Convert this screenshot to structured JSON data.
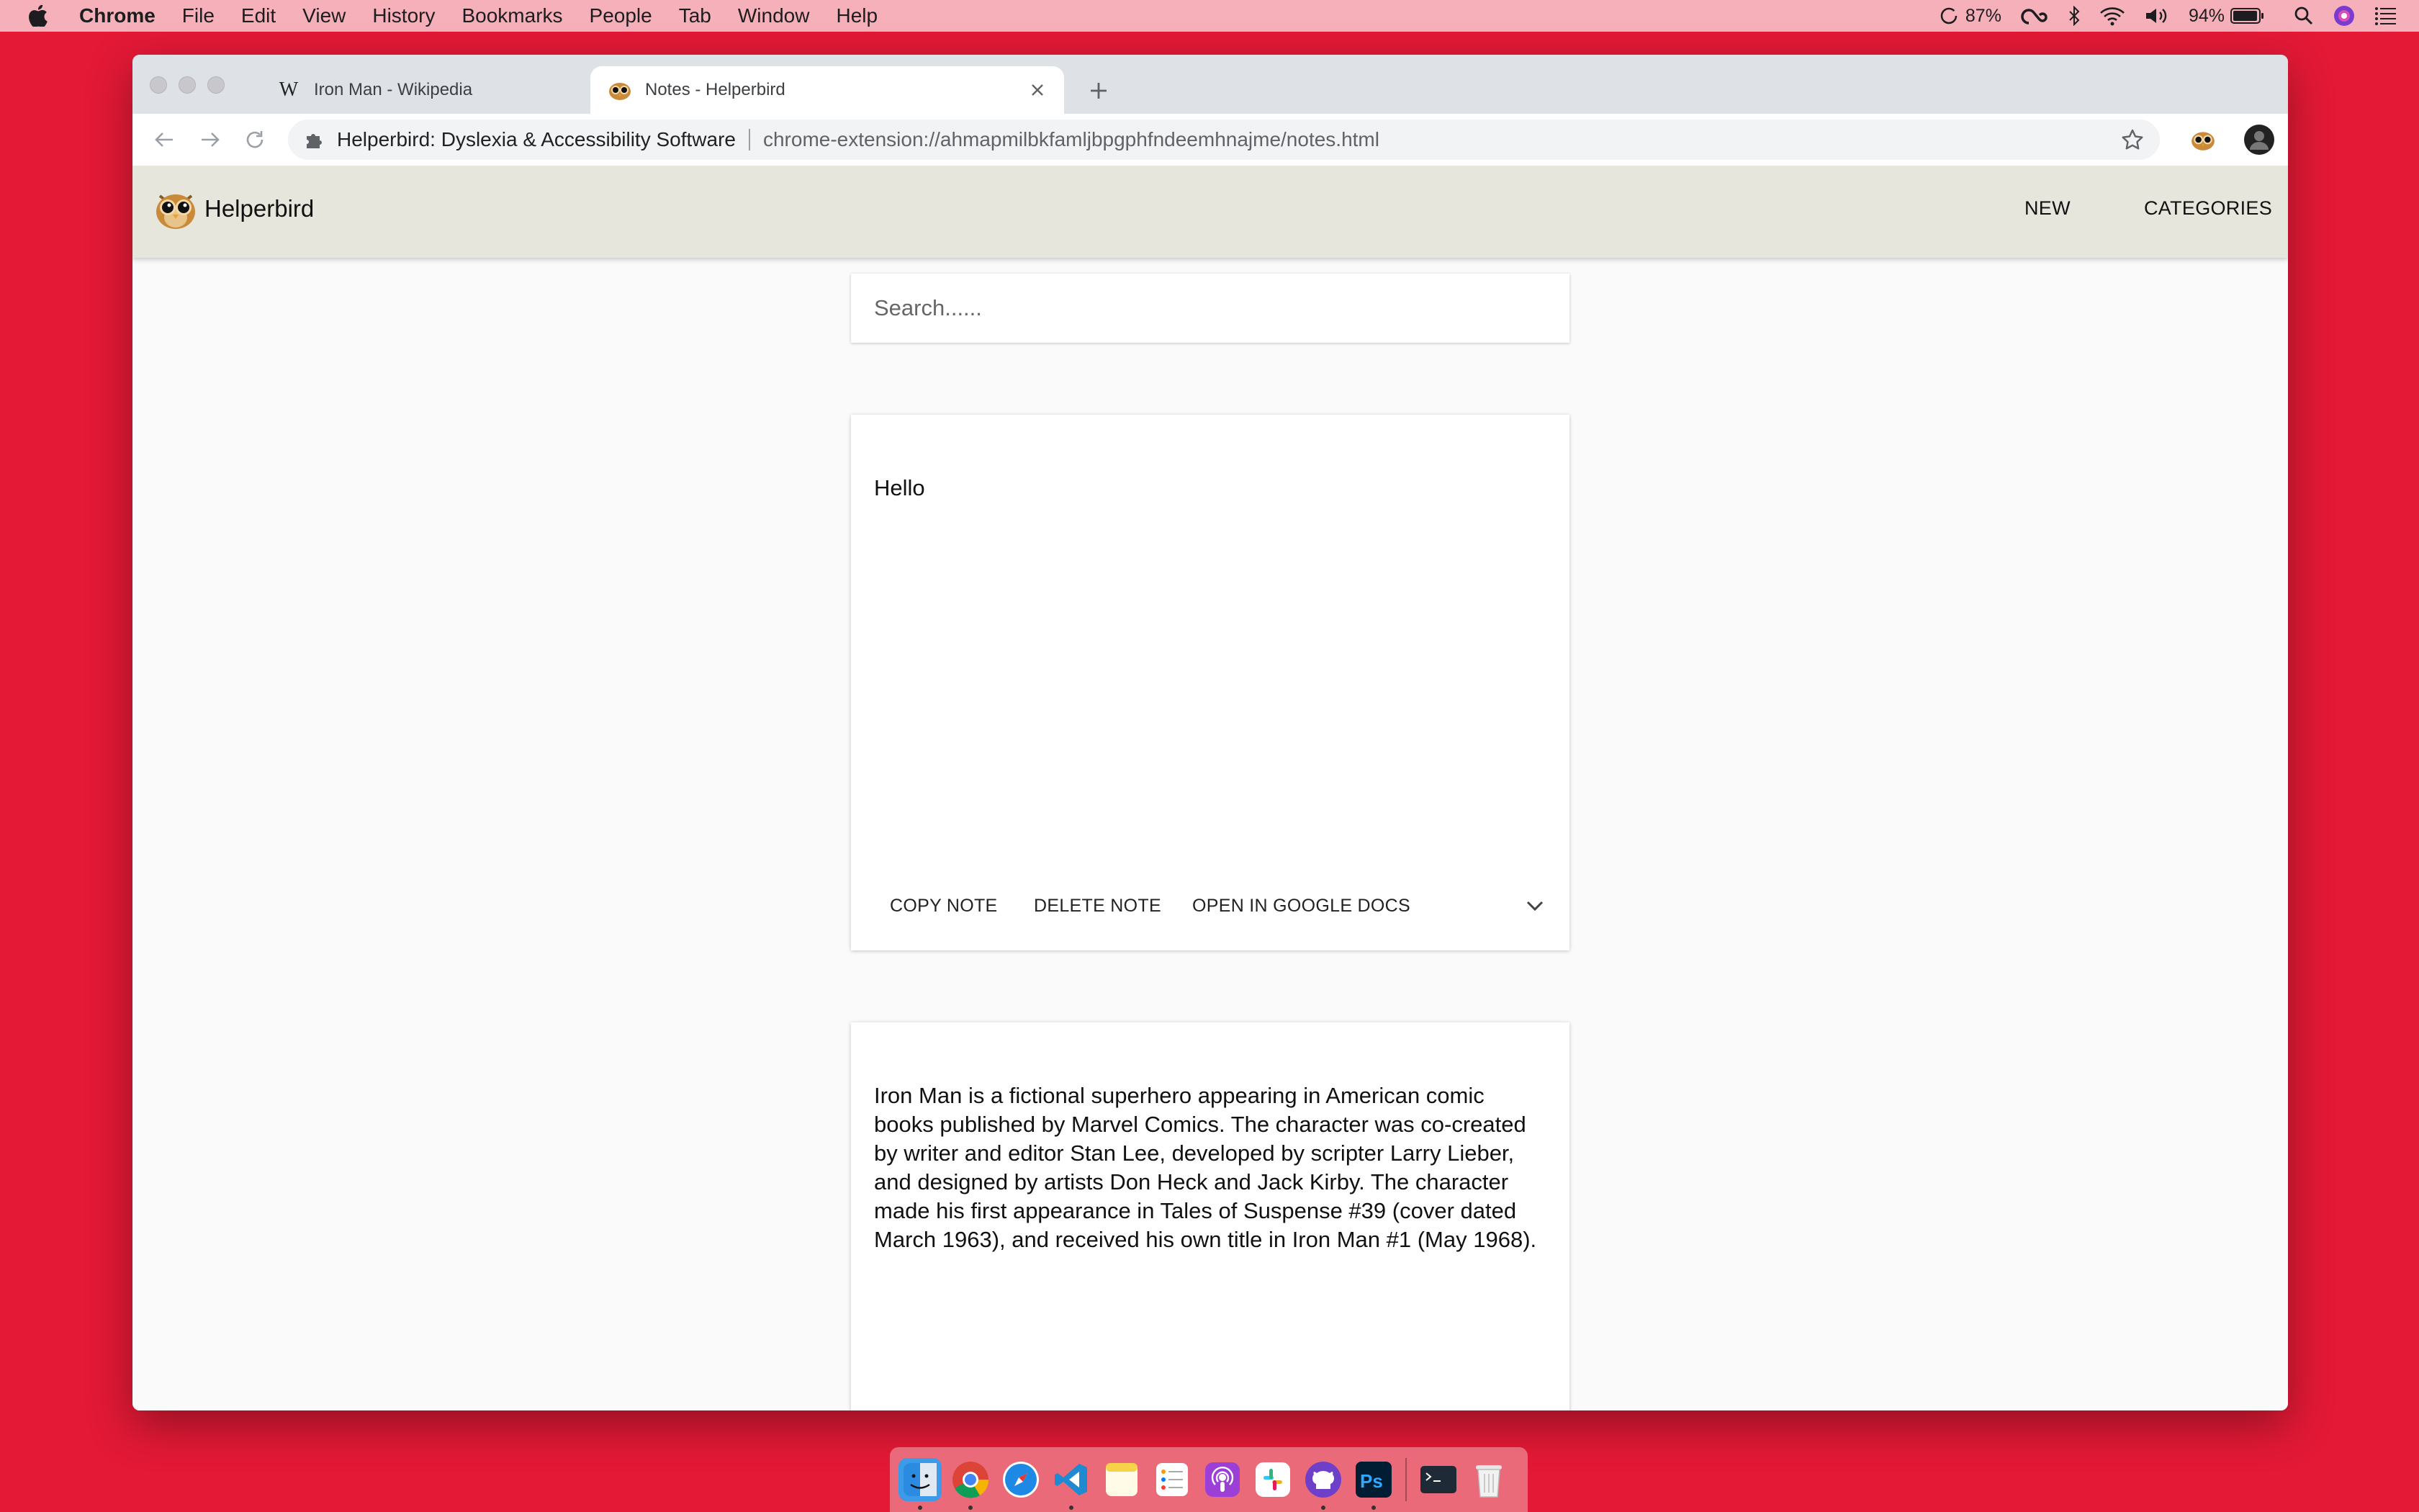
{
  "menubar": {
    "app_name": "Chrome",
    "items": [
      "File",
      "Edit",
      "View",
      "History",
      "Bookmarks",
      "People",
      "Tab",
      "Window",
      "Help"
    ],
    "status": {
      "cpu": "87%",
      "battery": "94%"
    }
  },
  "browser": {
    "tabs": [
      {
        "title": "Iron Man - Wikipedia",
        "favicon": "wikipedia-icon",
        "favicon_text": "W"
      },
      {
        "title": "Notes - Helperbird",
        "favicon": "helperbird-owl-icon"
      }
    ],
    "omnibox": {
      "site_name": "Helperbird: Dyslexia & Accessibility Software",
      "url": "chrome-extension://ahmapmilbkfamljbpgphfndeemhnajme/notes.html"
    }
  },
  "app": {
    "brand": "Helperbird",
    "nav": {
      "new_label": "NEW",
      "categories_label": "CATEGORIES"
    },
    "search": {
      "placeholder": "Search......"
    },
    "notes": [
      {
        "text": "Hello",
        "actions": {
          "copy": "COPY NOTE",
          "delete": "DELETE NOTE",
          "open_docs": "OPEN IN GOOGLE DOCS"
        }
      },
      {
        "text": "Iron Man is a fictional superhero appearing in American comic books published by Marvel Comics. The character was co-created by writer and editor Stan Lee, developed by scripter Larry Lieber, and designed by artists Don Heck and Jack Kirby. The character made his first appearance in Tales of Suspense #39 (cover dated March 1963), and received his own title in Iron Man #1 (May 1968)."
      }
    ]
  },
  "dock": {
    "items": [
      "finder-icon",
      "chrome-icon",
      "safari-icon",
      "vscode-icon",
      "notes-icon",
      "reminders-icon",
      "podcasts-icon",
      "slack-icon",
      "github-icon",
      "photoshop-icon",
      "terminal-icon",
      "trash-icon"
    ]
  },
  "colors": {
    "desktop": "#e31936",
    "menubar": "#f5b0ba",
    "appbar": "#e7e6dc"
  }
}
